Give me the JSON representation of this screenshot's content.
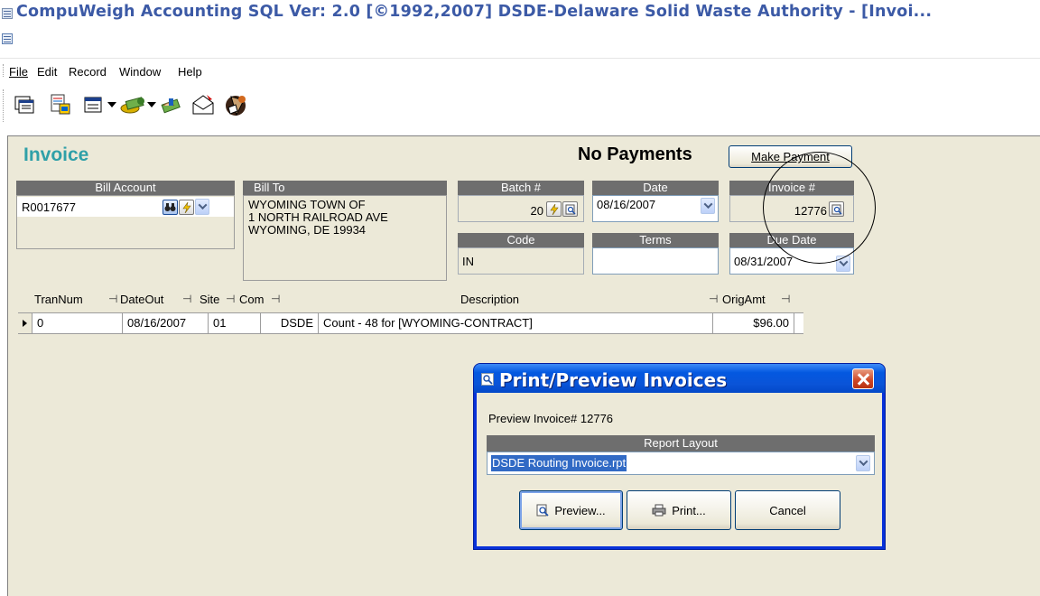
{
  "window": {
    "title": "CompuWeigh Accounting SQL Ver: 2.0 [©1992,2007]  DSDE-Delaware Solid Waste Authority - [Invoi..."
  },
  "menu": [
    "File",
    "Edit",
    "Record",
    "Window",
    "Help"
  ],
  "toolbar": {
    "icons": [
      "window-list-icon",
      "report-icon",
      "calculator-icon",
      "money-icon",
      "handshake-icon",
      "envelope-icon",
      "exit-door-icon"
    ]
  },
  "invoice": {
    "title": "Invoice",
    "payment_status": "No Payments",
    "make_payment_label": "Make Payment",
    "bill_account": {
      "header": "Bill Account",
      "value": "R0017677"
    },
    "bill_to": {
      "header": "Bill To",
      "lines": [
        "WYOMING TOWN OF",
        "1 NORTH RAILROAD AVE",
        "WYOMING, DE 19934"
      ]
    },
    "batch": {
      "header": "Batch #",
      "value": "20"
    },
    "date": {
      "header": "Date",
      "value": "08/16/2007"
    },
    "invoice_no": {
      "header": "Invoice #",
      "value": "12776"
    },
    "code": {
      "header": "Code",
      "value": "IN"
    },
    "terms": {
      "header": "Terms",
      "value": ""
    },
    "due_date": {
      "header": "Due Date",
      "value": "08/31/2007"
    }
  },
  "grid": {
    "columns": [
      "TranNum",
      "DateOut",
      "Site",
      "Com",
      "Description",
      "OrigAmt"
    ],
    "rows": [
      {
        "TranNum": "0",
        "DateOut": "08/16/2007",
        "Site": "01",
        "Com": "DSDE",
        "Description": "Count - 48 for [WYOMING-CONTRACT]",
        "OrigAmt": "$96.00"
      }
    ]
  },
  "dialog": {
    "title": "Print/Preview Invoices",
    "message": "Preview Invoice# 12776",
    "report_layout_header": "Report Layout",
    "report_layout_value": "DSDE Routing Invoice.rpt",
    "buttons": {
      "preview": "Preview...",
      "print": "Print...",
      "cancel": "Cancel"
    }
  },
  "colors": {
    "title_text": "#3c5aa6",
    "invoice_title": "#2fa0a8",
    "form_bg": "#ece9d8",
    "group_header": "#6e6e6e",
    "dialog_titlebar": "#0a54d8",
    "selection": "#316ac5"
  }
}
